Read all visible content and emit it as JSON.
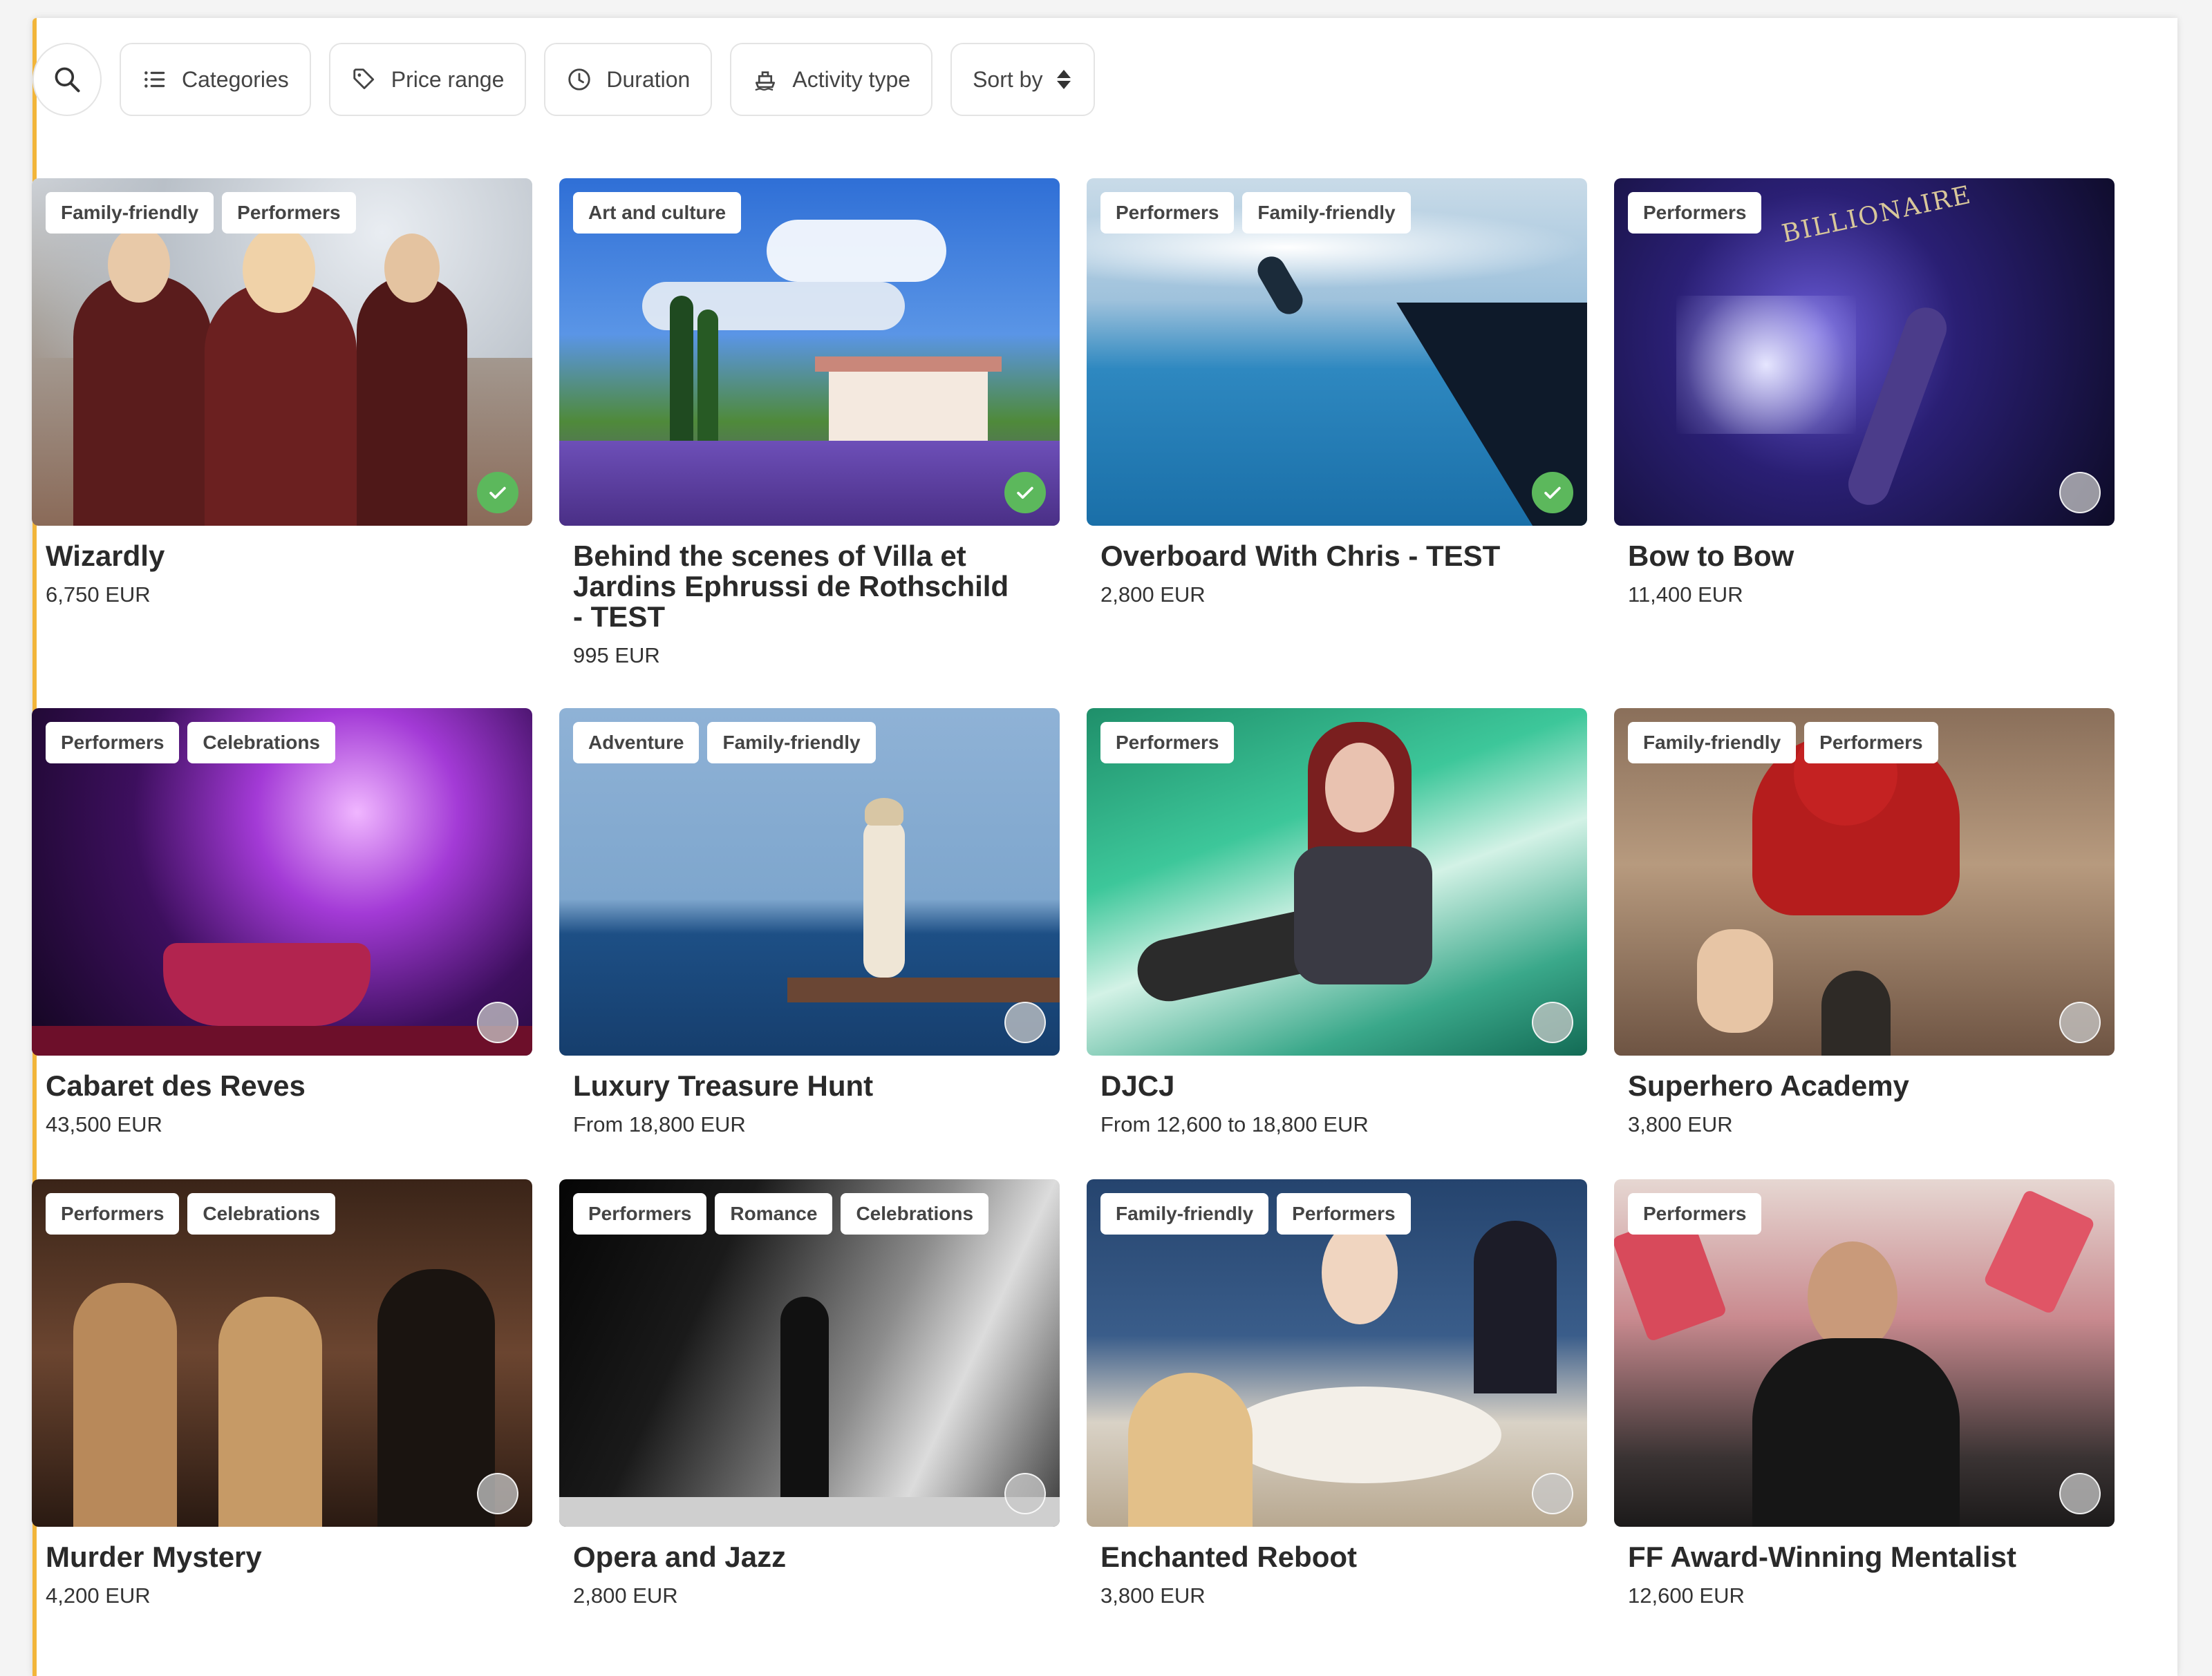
{
  "filters": {
    "categories": "Categories",
    "price_range": "Price range",
    "duration": "Duration",
    "activity_type": "Activity type",
    "sort_by": "Sort by"
  },
  "colors": {
    "accent": "#f2b53a",
    "selected": "#5cb85c"
  },
  "cards": [
    {
      "title": "Wizardly",
      "price": "6,750 EUR",
      "tags": [
        "Family-friendly",
        "Performers"
      ],
      "selected": true
    },
    {
      "title": "Behind the scenes of Villa et Jardins Ephrussi de Rothschild - TEST",
      "price": "995 EUR",
      "tags": [
        "Art and culture"
      ],
      "selected": true
    },
    {
      "title": "Overboard With Chris - TEST",
      "price": "2,800 EUR",
      "tags": [
        "Performers",
        "Family-friendly"
      ],
      "selected": true
    },
    {
      "title": "Bow to Bow",
      "price": "11,400 EUR",
      "tags": [
        "Performers"
      ],
      "selected": false
    },
    {
      "title": "Cabaret des Reves",
      "price": "43,500 EUR",
      "tags": [
        "Performers",
        "Celebrations"
      ],
      "selected": false
    },
    {
      "title": "Luxury Treasure Hunt",
      "price": "From 18,800 EUR",
      "tags": [
        "Adventure",
        "Family-friendly"
      ],
      "selected": false
    },
    {
      "title": "DJCJ",
      "price": "From 12,600 to 18,800 EUR",
      "tags": [
        "Performers"
      ],
      "selected": false
    },
    {
      "title": "Superhero Academy",
      "price": "3,800 EUR",
      "tags": [
        "Family-friendly",
        "Performers"
      ],
      "selected": false
    },
    {
      "title": "Murder Mystery",
      "price": "4,200 EUR",
      "tags": [
        "Performers",
        "Celebrations"
      ],
      "selected": false
    },
    {
      "title": "Opera and Jazz",
      "price": "2,800 EUR",
      "tags": [
        "Performers",
        "Romance",
        "Celebrations"
      ],
      "selected": false
    },
    {
      "title": "Enchanted Reboot",
      "price": "3,800 EUR",
      "tags": [
        "Family-friendly",
        "Performers"
      ],
      "selected": false
    },
    {
      "title": "FF Award-Winning Mentalist",
      "price": "12,600 EUR",
      "tags": [
        "Performers"
      ],
      "selected": false
    }
  ],
  "image_text": {
    "billionaire_sign": "BILLIONAIRE"
  }
}
